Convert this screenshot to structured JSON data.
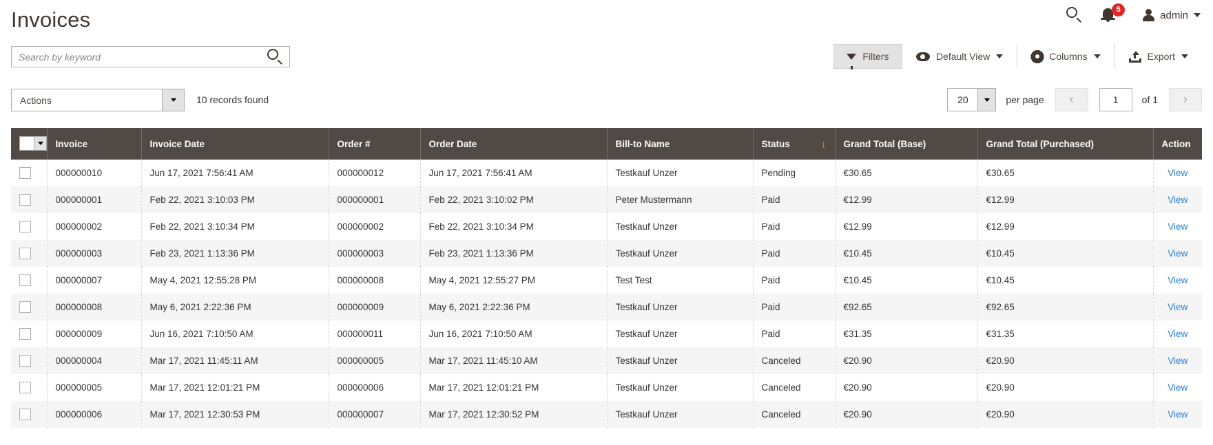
{
  "page": {
    "title": "Invoices"
  },
  "admin_bar": {
    "search_icon": "search-icon",
    "notifications": {
      "icon": "bell-icon",
      "count": "5",
      "badge_color": "#e22626"
    },
    "user": {
      "icon": "user-icon",
      "name": "admin",
      "caret": "chevron-down-icon"
    }
  },
  "search": {
    "placeholder": "Search by keyword",
    "value": "",
    "button_icon": "search-icon"
  },
  "toolbar": {
    "filters_label": "Filters",
    "filters_icon": "funnel-icon",
    "view_label": "Default View",
    "view_icon": "eye-icon",
    "columns_label": "Columns",
    "columns_icon": "gear-icon",
    "export_label": "Export",
    "export_icon": "upload-icon"
  },
  "actions": {
    "label": "Actions"
  },
  "records_found": "10 records found",
  "pagination": {
    "per_page_value": "20",
    "per_page_label": "per page",
    "prev_icon": "chevron-left-icon",
    "next_icon": "chevron-right-icon",
    "current_page": "1",
    "of_label": "of 1"
  },
  "grid": {
    "sort_column": "Status",
    "sort_direction_icon": "arrow-down-icon",
    "columns": [
      {
        "key": "check",
        "label": ""
      },
      {
        "key": "invoice",
        "label": "Invoice"
      },
      {
        "key": "invoice_date",
        "label": "Invoice Date"
      },
      {
        "key": "order_no",
        "label": "Order #"
      },
      {
        "key": "order_date",
        "label": "Order Date"
      },
      {
        "key": "bill_to",
        "label": "Bill-to Name"
      },
      {
        "key": "status",
        "label": "Status"
      },
      {
        "key": "grand_total_base",
        "label": "Grand Total (Base)"
      },
      {
        "key": "grand_total_purchased",
        "label": "Grand Total (Purchased)"
      },
      {
        "key": "action",
        "label": "Action"
      }
    ],
    "action_link_label": "View",
    "rows": [
      {
        "invoice": "000000010",
        "invoice_date": "Jun 17, 2021 7:56:41 AM",
        "order_no": "000000012",
        "order_date": "Jun 17, 2021 7:56:41 AM",
        "bill_to": "Testkauf Unzer",
        "status": "Pending",
        "grand_total_base": "€30.65",
        "grand_total_purchased": "€30.65",
        "action": "View"
      },
      {
        "invoice": "000000001",
        "invoice_date": "Feb 22, 2021 3:10:03 PM",
        "order_no": "000000001",
        "order_date": "Feb 22, 2021 3:10:02 PM",
        "bill_to": "Peter Mustermann",
        "status": "Paid",
        "grand_total_base": "€12.99",
        "grand_total_purchased": "€12.99",
        "action": "View"
      },
      {
        "invoice": "000000002",
        "invoice_date": "Feb 22, 2021 3:10:34 PM",
        "order_no": "000000002",
        "order_date": "Feb 22, 2021 3:10:34 PM",
        "bill_to": "Testkauf Unzer",
        "status": "Paid",
        "grand_total_base": "€12.99",
        "grand_total_purchased": "€12.99",
        "action": "View"
      },
      {
        "invoice": "000000003",
        "invoice_date": "Feb 23, 2021 1:13:36 PM",
        "order_no": "000000003",
        "order_date": "Feb 23, 2021 1:13:36 PM",
        "bill_to": "Testkauf Unzer",
        "status": "Paid",
        "grand_total_base": "€10.45",
        "grand_total_purchased": "€10.45",
        "action": "View"
      },
      {
        "invoice": "000000007",
        "invoice_date": "May 4, 2021 12:55:28 PM",
        "order_no": "000000008",
        "order_date": "May 4, 2021 12:55:27 PM",
        "bill_to": "Test Test",
        "status": "Paid",
        "grand_total_base": "€10.45",
        "grand_total_purchased": "€10.45",
        "action": "View"
      },
      {
        "invoice": "000000008",
        "invoice_date": "May 6, 2021 2:22:36 PM",
        "order_no": "000000009",
        "order_date": "May 6, 2021 2:22:36 PM",
        "bill_to": "Testkauf Unzer",
        "status": "Paid",
        "grand_total_base": "€92.65",
        "grand_total_purchased": "€92.65",
        "action": "View"
      },
      {
        "invoice": "000000009",
        "invoice_date": "Jun 16, 2021 7:10:50 AM",
        "order_no": "000000011",
        "order_date": "Jun 16, 2021 7:10:50 AM",
        "bill_to": "Testkauf Unzer",
        "status": "Paid",
        "grand_total_base": "€31.35",
        "grand_total_purchased": "€31.35",
        "action": "View"
      },
      {
        "invoice": "000000004",
        "invoice_date": "Mar 17, 2021 11:45:11 AM",
        "order_no": "000000005",
        "order_date": "Mar 17, 2021 11:45:10 AM",
        "bill_to": "Testkauf Unzer",
        "status": "Canceled",
        "grand_total_base": "€20.90",
        "grand_total_purchased": "€20.90",
        "action": "View"
      },
      {
        "invoice": "000000005",
        "invoice_date": "Mar 17, 2021 12:01:21 PM",
        "order_no": "000000006",
        "order_date": "Mar 17, 2021 12:01:21 PM",
        "bill_to": "Testkauf Unzer",
        "status": "Canceled",
        "grand_total_base": "€20.90",
        "grand_total_purchased": "€20.90",
        "action": "View"
      },
      {
        "invoice": "000000006",
        "invoice_date": "Mar 17, 2021 12:30:53 PM",
        "order_no": "000000007",
        "order_date": "Mar 17, 2021 12:30:52 PM",
        "bill_to": "Testkauf Unzer",
        "status": "Canceled",
        "grand_total_base": "€20.90",
        "grand_total_purchased": "€20.90",
        "action": "View"
      }
    ]
  },
  "colors": {
    "header_bg": "#514943",
    "link": "#2a7fd4",
    "badge": "#e22626",
    "sort_arrow": "#ff9d5a"
  }
}
